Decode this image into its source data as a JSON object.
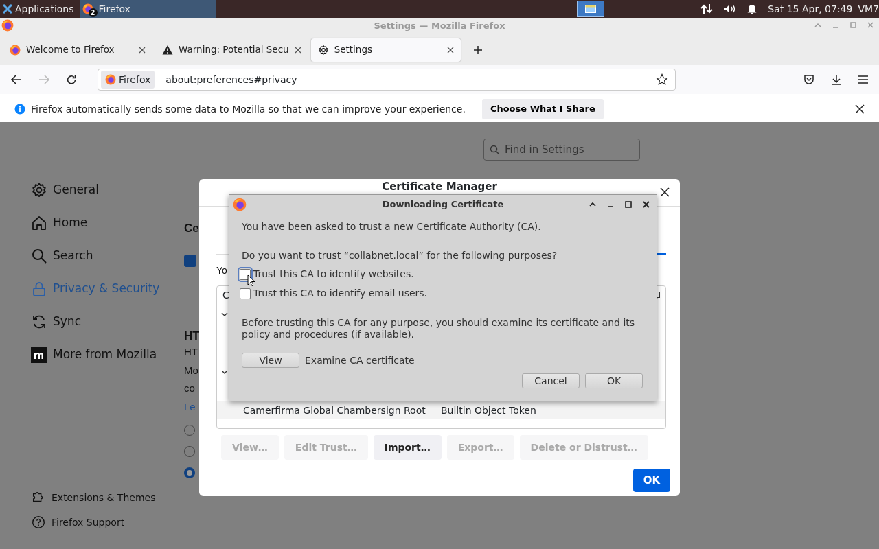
{
  "taskbar": {
    "menu": "Applications",
    "task": {
      "label": "Firefox",
      "badge": "2"
    },
    "clock": "Sat 15 Apr, 07:49",
    "user": "VM7"
  },
  "window": {
    "title": "Settings — Mozilla Firefox"
  },
  "tabs": [
    {
      "label": "Welcome to Firefox",
      "kind": "firefox",
      "selected": false
    },
    {
      "label": "Warning: Potential Secu",
      "kind": "warning",
      "selected": false
    },
    {
      "label": "Settings",
      "kind": "gear",
      "selected": true
    }
  ],
  "address": {
    "identity": "Firefox",
    "url": "about:preferences#privacy"
  },
  "notification": {
    "message": "Firefox automatically sends some data to Mozilla so that we can improve your experience.",
    "button": "Choose What I Share"
  },
  "search": {
    "placeholder": "Find in Settings"
  },
  "sidebar": {
    "items": [
      {
        "label": "General",
        "selected": false
      },
      {
        "label": "Home",
        "selected": false
      },
      {
        "label": "Search",
        "selected": false
      },
      {
        "label": "Privacy & Security",
        "selected": true
      },
      {
        "label": "Sync",
        "selected": false
      },
      {
        "label": "More from Mozilla",
        "selected": false
      }
    ],
    "footer": [
      {
        "label": "Extensions & Themes"
      },
      {
        "label": "Firefox Support"
      }
    ]
  },
  "page_behind": {
    "heading_1": "Ce",
    "checkbox": {
      "checked": true
    },
    "heading_2": "HT",
    "lines": [
      "HT",
      "Mo",
      "co"
    ],
    "link": "Le",
    "radios": [
      {
        "selected": false
      },
      {
        "selected": false
      },
      {
        "selected": true
      }
    ]
  },
  "certificate_manager": {
    "title": "Certificate Manager",
    "intro": "Yo",
    "column_1": "C",
    "rows": [
      {
        "kind": "group"
      },
      {
        "kind": "group"
      },
      {
        "kind": "cert",
        "name": "Camerfirma Global Chambersign Root",
        "device": "Builtin Object Token"
      }
    ],
    "buttons": [
      {
        "label": "View…",
        "disabled": true
      },
      {
        "label": "Edit Trust…",
        "disabled": true
      },
      {
        "label": "Import…",
        "disabled": false
      },
      {
        "label": "Export…",
        "disabled": true
      },
      {
        "label": "Delete or Distrust…",
        "disabled": true
      }
    ],
    "ok": "OK"
  },
  "download_dialog": {
    "title": "Downloading Certificate",
    "intro": "You have been asked to trust a new Certificate Authority (CA).",
    "question": "Do you want to trust “collabnet.local” for the following purposes?",
    "options": [
      {
        "label": "Trust this CA to identify websites.",
        "checked": false,
        "focused": true
      },
      {
        "label": "Trust this CA to identify email users.",
        "checked": false,
        "focused": false
      }
    ],
    "note": "Before trusting this CA for any purpose, you should examine its certificate and its policy and procedures (if available).",
    "view_button": "View",
    "view_caption": "Examine CA certificate",
    "cancel": "Cancel",
    "ok": "OK"
  }
}
